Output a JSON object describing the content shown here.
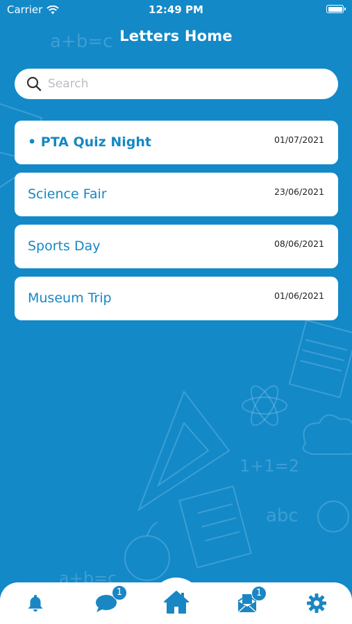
{
  "status_bar": {
    "carrier": "Carrier",
    "time": "12:49 PM"
  },
  "header": {
    "title": "Letters Home"
  },
  "search": {
    "placeholder": "Search"
  },
  "letters": [
    {
      "title": "PTA Quiz Night",
      "date": "01/07/2021",
      "unread": true
    },
    {
      "title": "Science Fair",
      "date": "23/06/2021",
      "unread": false
    },
    {
      "title": "Sports Day",
      "date": "08/06/2021",
      "unread": false
    },
    {
      "title": "Museum Trip",
      "date": "01/06/2021",
      "unread": false
    }
  ],
  "tab_bar": {
    "tabs": [
      {
        "icon": "bell-icon"
      },
      {
        "icon": "chat-bubble-icon",
        "badge": "1"
      },
      {
        "icon": "home-icon"
      },
      {
        "icon": "envelope-icon",
        "badge": "1"
      },
      {
        "icon": "gear-icon"
      }
    ]
  },
  "colors": {
    "background": "#1389c8",
    "accent": "#1588c3",
    "card": "#ffffff"
  }
}
